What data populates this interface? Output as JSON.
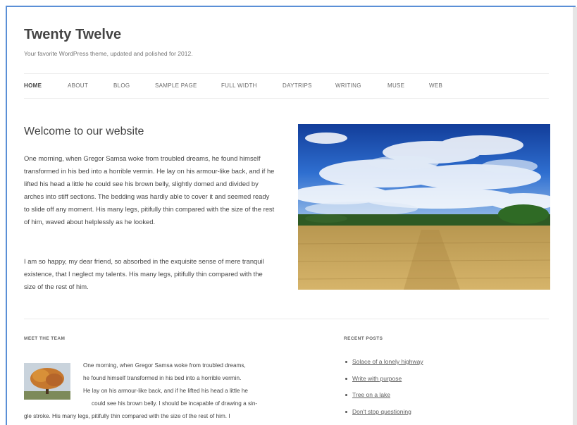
{
  "site": {
    "title": "Twenty Twelve",
    "description": "Your favorite WordPress theme, updated and polished for 2012."
  },
  "nav": {
    "items": [
      "HOME",
      "ABOUT",
      "BLOG",
      "SAMPLE PAGE",
      "FULL WIDTH",
      "DAYTRIPS",
      "WRITING",
      "MUSE",
      "WEB"
    ],
    "active_index": 0
  },
  "main": {
    "title": "Welcome to our website",
    "paragraph1": "One morning, when Gregor Samsa woke from troubled dreams, he found himself transformed in his bed into a horrible vermin. He lay on his armour-like back, and if he lifted his head a little he could see his brown belly, slightly domed and divided by arches into stiff sections. The bedding was hardly able to cover it and seemed ready to slide off any moment. His many legs, pitifully thin compared with the size of the rest of him, waved about helplessly as he looked.",
    "paragraph2": "I am so happy, my dear friend, so absorbed in the exquisite sense of mere tranquil existence, that I neglect my talents. His many legs, pitifully thin compared with the size of the rest of him."
  },
  "widgets": {
    "team": {
      "title": "MEET THE TEAM",
      "lines": [
        "One morning, when Gregor Samsa woke from troubled dreams,",
        "he found himself transformed in his bed into a horrible vermin.",
        "He lay on his armour-like back, and if he lifted his head a little he",
        "could see his brown belly. I should be incapable of drawing a sin-",
        "gle stroke. His many legs, pitifully thin compared with the size of the rest of him. I"
      ]
    },
    "recent": {
      "title": "RECENT POSTS",
      "items": [
        "Solace of a lonely highway",
        "Write with purpose",
        "Tree on a lake",
        "Don't stop questioning"
      ]
    }
  },
  "colors": {
    "frame_border": "#5b8fd6",
    "text": "#444444",
    "sky": "#1f5fc4",
    "field": "#c9a85a",
    "tree_foliage": "#c6782e"
  },
  "icons": {
    "hero_image": "sky-wheat-field-image",
    "team_image": "autumn-tree-image"
  }
}
